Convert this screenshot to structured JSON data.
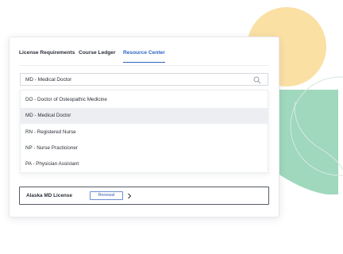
{
  "tabs": [
    {
      "label": "License Requirements",
      "active": false
    },
    {
      "label": "Course Ledger",
      "active": false
    },
    {
      "label": "Resource Center",
      "active": true
    }
  ],
  "search": {
    "value": "MD - Medical Doctor",
    "icon": "search-icon"
  },
  "dropdown": {
    "options": [
      {
        "label": "DO - Doctor of Osteopathic Medicine",
        "selected": false
      },
      {
        "label": "MD - Medical Doctor",
        "selected": true
      },
      {
        "label": "RN - Registered Nurse",
        "selected": false
      },
      {
        "label": "NP - Nurse Practicioner",
        "selected": false
      },
      {
        "label": "PA - Physician Assistant",
        "selected": false
      }
    ]
  },
  "license": {
    "name": "Alaska MD License",
    "action_label": "Renewal",
    "chevron_icon": "chevron-right-icon"
  },
  "colors": {
    "accent": "#2f63c7",
    "decor_yellow": "#fbe0a4",
    "decor_green": "#9fd8bd"
  }
}
